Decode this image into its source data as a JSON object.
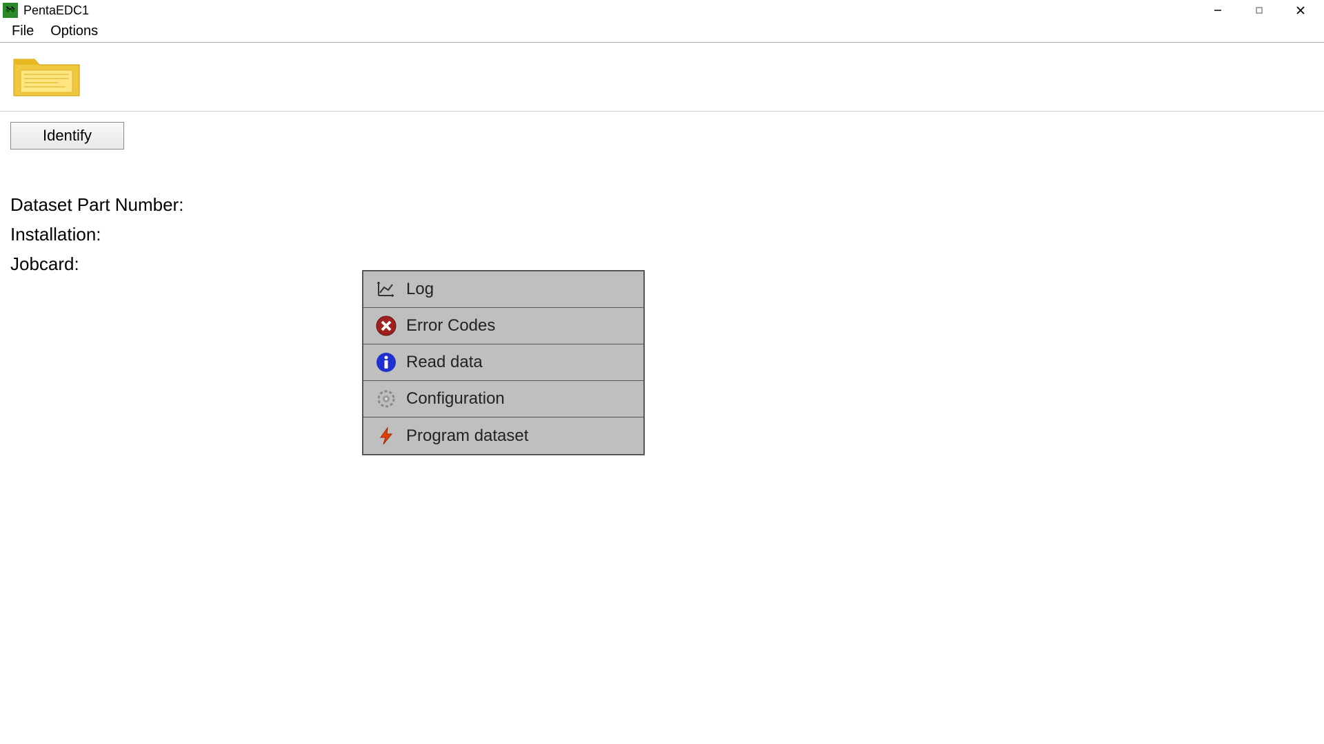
{
  "window": {
    "title": "PentaEDC1"
  },
  "menubar": {
    "file": "File",
    "options": "Options"
  },
  "buttons": {
    "identify": "Identify"
  },
  "labels": {
    "dataset_part_number": "Dataset Part Number:",
    "installation": "Installation:",
    "jobcard": "Jobcard:"
  },
  "menu_panel": {
    "log": "Log",
    "error_codes": "Error Codes",
    "read_data": "Read data",
    "configuration": "Configuration",
    "program_dataset": "Program dataset"
  }
}
